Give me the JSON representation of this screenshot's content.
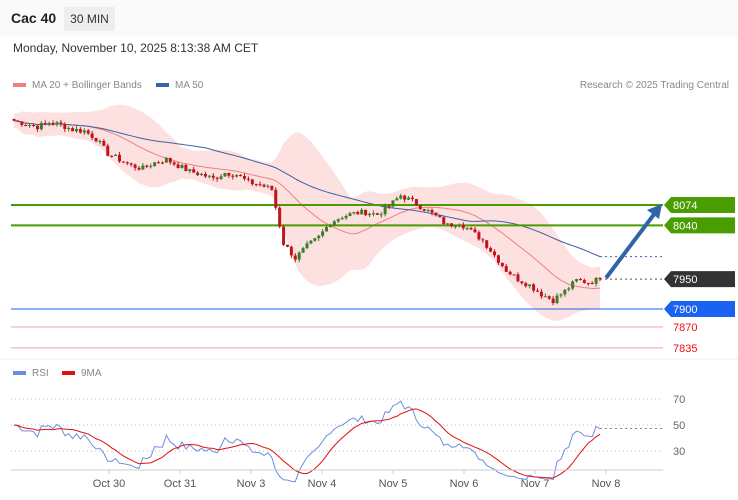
{
  "header": {
    "title": "Cac 40",
    "timeframe": "30 MIN",
    "datetime": "Monday, November 10, 2025 8:13:38 AM CET"
  },
  "legend": {
    "ma20": "MA 20 + Bollinger Bands",
    "ma50": "MA 50",
    "research": "Research © 2025 Trading Central",
    "rsi": "RSI",
    "rsi_ma": "9MA"
  },
  "colors": {
    "up": "#3d7d2a",
    "down": "#c0141c",
    "ma20": "#f08080",
    "ma50": "#3a63a8",
    "band": "#fde0e0",
    "green": "#4a9d00",
    "blue": "#1a62f0",
    "dark": "#333333",
    "red": "#f01010",
    "rsi": "#6a8ee0",
    "rsi_ma": "#e01010"
  },
  "chart_data": {
    "type": "candlestick",
    "x_ticks": [
      "Oct 30",
      "Oct 31",
      "Nov 3",
      "Nov 4",
      "Nov 5",
      "Nov 6",
      "Nov 7",
      "Nov 8"
    ],
    "price_path": [
      8215,
      8210,
      8205,
      8212,
      8208,
      8200,
      8198,
      8185,
      8160,
      8150,
      8140,
      8135,
      8145,
      8150,
      8140,
      8130,
      8125,
      8118,
      8128,
      8125,
      8112,
      8108,
      8100,
      8010,
      7985,
      8005,
      8020,
      8045,
      8055,
      8060,
      8062,
      8058,
      8072,
      8090,
      8080,
      8068,
      8055,
      8040,
      8045,
      8030,
      8015,
      7990,
      7965,
      7950,
      7940,
      7925,
      7915,
      7930,
      7948,
      7945,
      7950
    ],
    "price_range": [
      7820,
      8230
    ],
    "levels": [
      {
        "label": "8074",
        "value": 8074,
        "type": "resistance"
      },
      {
        "label": "8040",
        "value": 8040,
        "type": "resistance"
      },
      {
        "label": "7950",
        "value": 7950,
        "type": "current"
      },
      {
        "label": "7900",
        "value": 7900,
        "type": "pivot"
      },
      {
        "label": "7870",
        "value": 7870,
        "type": "support"
      },
      {
        "label": "7835",
        "value": 7835,
        "type": "support"
      }
    ],
    "target": 8074,
    "rsi_ticks": [
      "70",
      "50",
      "30"
    ],
    "rsi_range": [
      20,
      80
    ]
  }
}
